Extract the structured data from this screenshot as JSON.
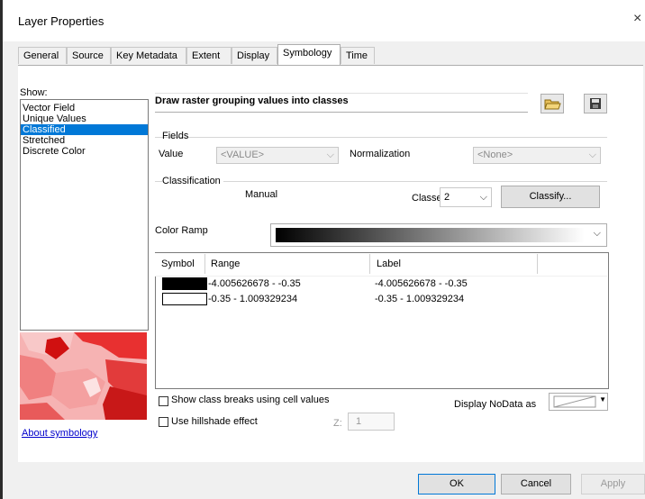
{
  "window": {
    "title": "Layer Properties",
    "close_glyph": "×"
  },
  "tabs": [
    {
      "label": "General"
    },
    {
      "label": "Source"
    },
    {
      "label": "Key Metadata"
    },
    {
      "label": "Extent"
    },
    {
      "label": "Display"
    },
    {
      "label": "Symbology",
      "active": true
    },
    {
      "label": "Time"
    }
  ],
  "show": {
    "label": "Show:",
    "items": [
      "Vector Field",
      "Unique Values",
      "Classified",
      "Stretched",
      "Discrete Color"
    ],
    "selected": "Classified"
  },
  "description": "Draw raster grouping values into classes",
  "fields": {
    "group_label": "Fields",
    "value_label": "Value",
    "value_selected": "<VALUE>",
    "normalization_label": "Normalization",
    "normalization_selected": "<None>"
  },
  "classification": {
    "group_label": "Classification",
    "method": "Manual",
    "classes_label": "Classes",
    "classes_value": "2",
    "classify_button": "Classify..."
  },
  "color_ramp": {
    "label": "Color Ramp",
    "colors": [
      "#000000",
      "#ffffff"
    ]
  },
  "table": {
    "headers": [
      "Symbol",
      "Range",
      "Label"
    ],
    "rows": [
      {
        "color": "#000000",
        "range": "-4.005626678 - -0.35",
        "label": "-4.005626678 - -0.35"
      },
      {
        "color": "#ffffff",
        "range": "-0.35 - 1.009329234",
        "label": "-0.35 - 1.009329234"
      }
    ]
  },
  "options": {
    "class_breaks_label": "Show class breaks using cell values",
    "hillshade_label": "Use hillshade effect",
    "z_label": "Z:",
    "z_value": "1",
    "nodata_label": "Display NoData as"
  },
  "about_link": "About symbology",
  "buttons": {
    "ok": "OK",
    "cancel": "Cancel",
    "apply": "Apply"
  }
}
